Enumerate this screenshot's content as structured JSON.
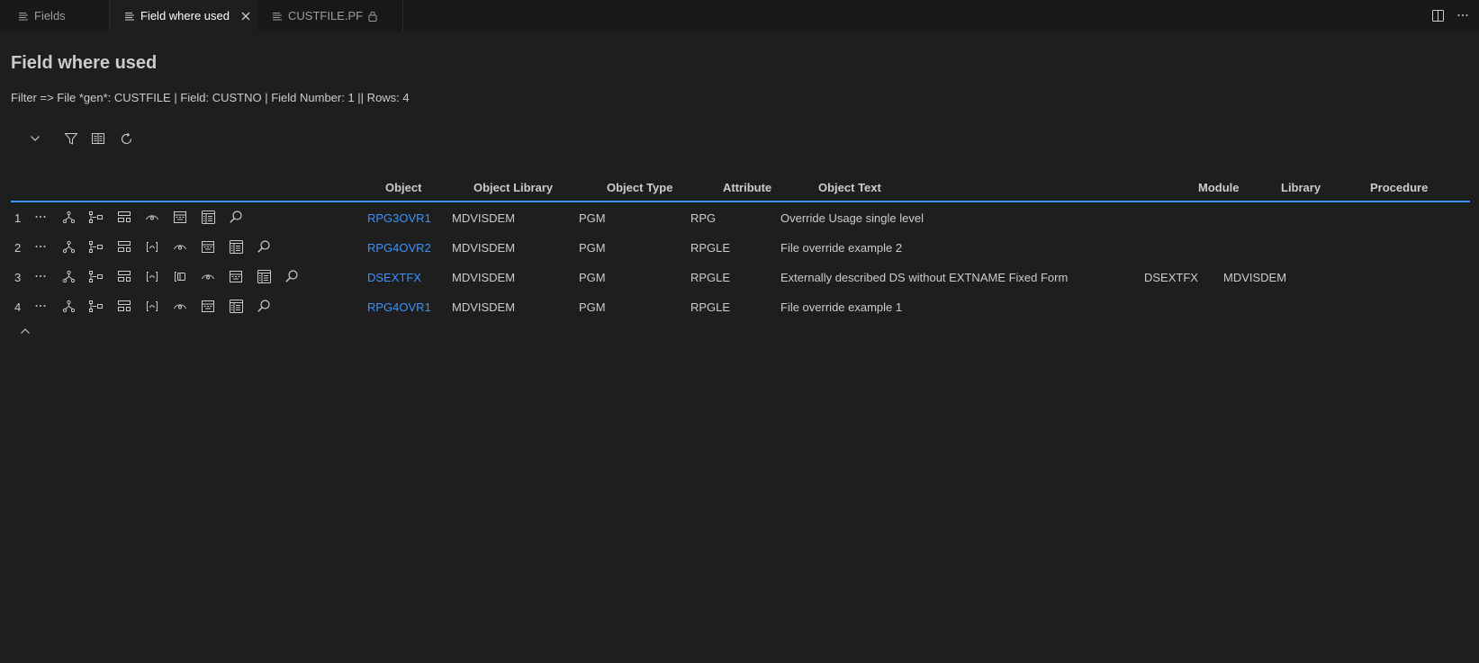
{
  "tabs": [
    {
      "label": "Fields",
      "icon": "lines-icon"
    },
    {
      "label": "Field where used",
      "icon": "lines-icon",
      "active": true
    },
    {
      "label": "CUSTFILE.PF",
      "icon": "lines-icon",
      "locked": true
    }
  ],
  "page": {
    "title": "Field where used",
    "filter": "Filter => File *gen*: CUSTFILE | Field: CUSTNO | Field Number: 1 || Rows: 4"
  },
  "toolbar": [
    "chevron-down-icon",
    "filter-icon",
    "columns-icon",
    "refresh-icon"
  ],
  "table": {
    "columns": [
      "Object",
      "Object Library",
      "Object Type",
      "Attribute",
      "Object Text",
      "Module",
      "Library",
      "Procedure"
    ],
    "rows": [
      {
        "num": "1",
        "object": "RPG3OVR1",
        "library": "MDVISDEM",
        "type": "PGM",
        "attribute": "RPG",
        "text": "Override Usage single level",
        "module": "",
        "lib2": "",
        "procedure": ""
      },
      {
        "num": "2",
        "object": "RPG4OVR2",
        "library": "MDVISDEM",
        "type": "PGM",
        "attribute": "RPGLE",
        "text": "File override example 2",
        "module": "",
        "lib2": "",
        "procedure": ""
      },
      {
        "num": "3",
        "object": "DSEXTFX",
        "library": "MDVISDEM",
        "type": "PGM",
        "attribute": "RPGLE",
        "text": "Externally described DS without EXTNAME Fixed Form",
        "module": "DSEXTFX",
        "lib2": "MDVISDEM",
        "procedure": ""
      },
      {
        "num": "4",
        "object": "RPG4OVR1",
        "library": "MDVISDEM",
        "type": "PGM",
        "attribute": "RPGLE",
        "text": "File override example 1",
        "module": "",
        "lib2": "",
        "procedure": ""
      }
    ]
  },
  "colors": {
    "background": "#1e1e1e",
    "link": "#3794ff",
    "header_rule": "#3794ff",
    "text": "#cccccc"
  }
}
